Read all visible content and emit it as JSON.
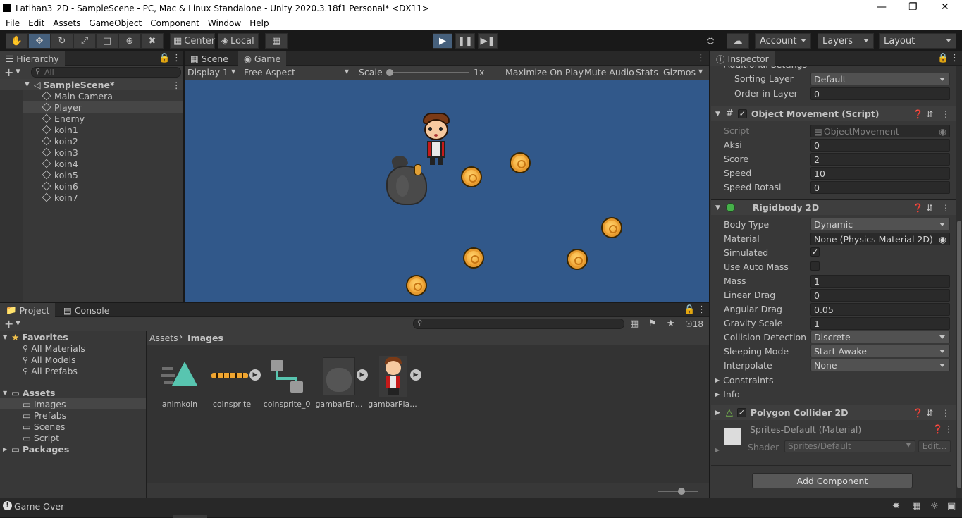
{
  "window": {
    "title": "Latihan3_2D - SampleScene - PC, Mac & Linux Standalone - Unity 2020.3.18f1 Personal* <DX11>"
  },
  "menu": [
    "File",
    "Edit",
    "Assets",
    "GameObject",
    "Component",
    "Window",
    "Help"
  ],
  "toolbar": {
    "center_label": "Center",
    "local_label": "Local",
    "account_label": "Account",
    "layers_label": "Layers",
    "layout_label": "Layout"
  },
  "hierarchy": {
    "tab": "Hierarchy",
    "search_placeholder": "All",
    "scene": "SampleScene*",
    "items": [
      "Main Camera",
      "Player",
      "Enemy",
      "koin1",
      "koin2",
      "koin3",
      "koin4",
      "koin5",
      "koin6",
      "koin7"
    ],
    "selected": "Player"
  },
  "game_view": {
    "tabs": [
      "Scene",
      "Game"
    ],
    "active_tab": "Game",
    "display": "Display 1",
    "aspect": "Free Aspect",
    "scale_label": "Scale",
    "scale_value": "1x",
    "maximize": "Maximize On Play",
    "mute": "Mute Audio",
    "stats": "Stats",
    "gizmos": "Gizmos",
    "background_color": "#31588a"
  },
  "project": {
    "tabs": [
      "Project",
      "Console"
    ],
    "favorites_label": "Favorites",
    "favorites": [
      "All Materials",
      "All Models",
      "All Prefabs"
    ],
    "assets_label": "Assets",
    "asset_folders": [
      "Images",
      "Prefabs",
      "Scenes",
      "Script"
    ],
    "packages_label": "Packages",
    "breadcrumb": [
      "Assets",
      "Images"
    ],
    "hidden_count": "18",
    "files": [
      "animkoin",
      "coinsprite",
      "coinsprite_0",
      "gambarEn...",
      "gambarPla..."
    ]
  },
  "inspector": {
    "tab": "Inspector",
    "additional_settings": "Additional Settings",
    "sorting_layer_label": "Sorting Layer",
    "sorting_layer_value": "Default",
    "order_in_layer_label": "Order in Layer",
    "order_in_layer_value": "0",
    "object_movement": {
      "title": "Object Movement (Script)",
      "script_label": "Script",
      "script_value": "ObjectMovement",
      "fields": [
        {
          "label": "Aksi",
          "value": "0"
        },
        {
          "label": "Score",
          "value": "2"
        },
        {
          "label": "Speed",
          "value": "10"
        },
        {
          "label": "Speed Rotasi",
          "value": "0"
        }
      ]
    },
    "rigidbody": {
      "title": "Rigidbody 2D",
      "body_type_label": "Body Type",
      "body_type": "Dynamic",
      "material_label": "Material",
      "material": "None (Physics Material 2D)",
      "simulated_label": "Simulated",
      "simulated": true,
      "use_auto_mass_label": "Use Auto Mass",
      "use_auto_mass": false,
      "mass_label": "Mass",
      "mass": "1",
      "linear_drag_label": "Linear Drag",
      "linear_drag": "0",
      "angular_drag_label": "Angular Drag",
      "angular_drag": "0.05",
      "gravity_scale_label": "Gravity Scale",
      "gravity_scale": "1",
      "collision_detection_label": "Collision Detection",
      "collision_detection": "Discrete",
      "sleeping_mode_label": "Sleeping Mode",
      "sleeping_mode": "Start Awake",
      "interpolate_label": "Interpolate",
      "interpolate": "None",
      "constraints": "Constraints",
      "info": "Info"
    },
    "polygon_collider": {
      "title": "Polygon Collider 2D"
    },
    "material": {
      "name": "Sprites-Default (Material)",
      "shader_label": "Shader",
      "shader": "Sprites/Default",
      "edit": "Edit..."
    },
    "add_component": "Add Component"
  },
  "status_bar": {
    "message": "Game Over"
  }
}
